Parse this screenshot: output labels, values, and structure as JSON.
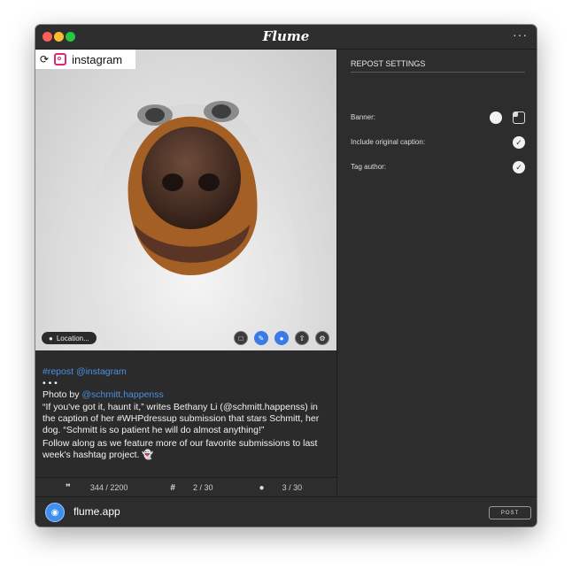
{
  "window": {
    "app_title": "Flume",
    "more_label": "···"
  },
  "account": {
    "handle": "instagram"
  },
  "photo": {
    "location_label": "Location..."
  },
  "caption": {
    "line1": "#repost @instagram",
    "line2": "• • •",
    "line3_prefix": "Photo by ",
    "line3_handle": "@schmitt.happenss",
    "line4": "“If you've got it, haunt it,” writes Bethany Li (@schmitt.happenss) in the caption of her #WHPdressup submission that stars Schmitt, her dog. “Schmitt is so patient he will do almost anything!”",
    "line5": "Follow along as we feature more of our favorite submissions to last week's hashtag project. 👻"
  },
  "stats": {
    "caption_count": "344 / 2200",
    "hashtag_count": "2 / 30",
    "mention_count": "3 / 30"
  },
  "settings": {
    "title": "REPOST SETTINGS",
    "banner_label": "Banner:",
    "include_caption_label": "Include original caption:",
    "tag_author_label": "Tag author:"
  },
  "footer": {
    "domain": "flume.app",
    "post_label": "POST"
  },
  "colors": {
    "window_bg": "#2d2d2d",
    "accent_blue": "#4a90e2",
    "camera_blue": "#3f8ff0"
  }
}
